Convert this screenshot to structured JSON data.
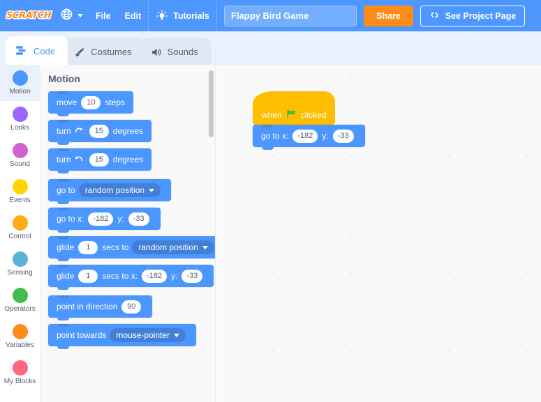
{
  "theme": {
    "menubar_bg": "#4d97ff",
    "accent_blue": "#4c97ff",
    "share_orange": "#ff8c1a",
    "tabstrip_bg": "#e9f1fc",
    "palette_bg": "#f9f9f9",
    "motion_block": "#4c97ff",
    "events_block": "#ffbf00",
    "text_gray": "#575e75"
  },
  "menubar": {
    "logo_text": "SCRATCH",
    "logo_icon": "scratch-logo",
    "language_icon": "globe-icon",
    "language_caret_icon": "chevron-down-icon",
    "file_label": "File",
    "edit_label": "Edit",
    "tutorials_icon": "lightbulb-icon",
    "tutorials_label": "Tutorials",
    "project_title_value": "Flappy Bird Game",
    "project_title_placeholder": "Project title",
    "share_label": "Share",
    "see_project_icon": "link-icon",
    "see_project_label": "See Project Page"
  },
  "tabs": [
    {
      "label": "Code",
      "icon": "code-blocks-icon",
      "active": true
    },
    {
      "label": "Costumes",
      "icon": "paintbrush-icon",
      "active": false
    },
    {
      "label": "Sounds",
      "icon": "speaker-icon",
      "active": false
    }
  ],
  "categories": [
    {
      "label": "Motion",
      "color": "#4c97ff",
      "selected": true
    },
    {
      "label": "Looks",
      "color": "#9966ff",
      "selected": false
    },
    {
      "label": "Sound",
      "color": "#cf63cf",
      "selected": false
    },
    {
      "label": "Events",
      "color": "#ffd500",
      "selected": false
    },
    {
      "label": "Control",
      "color": "#ffab19",
      "selected": false
    },
    {
      "label": "Sensing",
      "color": "#5cb1d6",
      "selected": false
    },
    {
      "label": "Operators",
      "color": "#40bf4a",
      "selected": false
    },
    {
      "label": "Variables",
      "color": "#ff8c1a",
      "selected": false
    },
    {
      "label": "My Blocks",
      "color": "#ff6680",
      "selected": false
    }
  ],
  "palette": {
    "header": "Motion",
    "scrollbar": {
      "name": "palette-scrollbar"
    },
    "blocks": [
      {
        "name": "move-steps-block",
        "parts": [
          {
            "type": "label",
            "text": "move"
          },
          {
            "type": "number",
            "value": "10"
          },
          {
            "type": "label",
            "text": "steps"
          }
        ]
      },
      {
        "name": "turn-right-degrees-block",
        "parts": [
          {
            "type": "label",
            "text": "turn"
          },
          {
            "type": "icon",
            "icon": "turn-clockwise-icon"
          },
          {
            "type": "number",
            "value": "15"
          },
          {
            "type": "label",
            "text": "degrees"
          }
        ]
      },
      {
        "name": "turn-left-degrees-block",
        "parts": [
          {
            "type": "label",
            "text": "turn"
          },
          {
            "type": "icon",
            "icon": "turn-counterclockwise-icon"
          },
          {
            "type": "number",
            "value": "15"
          },
          {
            "type": "label",
            "text": "degrees"
          }
        ]
      },
      {
        "name": "go-to-block",
        "parts": [
          {
            "type": "label",
            "text": "go to"
          },
          {
            "type": "dropdown",
            "value": "random position"
          }
        ]
      },
      {
        "name": "go-to-xy-block",
        "parts": [
          {
            "type": "label",
            "text": "go to x:"
          },
          {
            "type": "number",
            "value": "-182"
          },
          {
            "type": "label",
            "text": "y:"
          },
          {
            "type": "number",
            "value": "-33"
          }
        ]
      },
      {
        "name": "glide-secs-to-block",
        "parts": [
          {
            "type": "label",
            "text": "glide"
          },
          {
            "type": "number",
            "value": "1"
          },
          {
            "type": "label",
            "text": "secs to"
          },
          {
            "type": "dropdown",
            "value": "random position"
          }
        ]
      },
      {
        "name": "glide-secs-to-xy-block",
        "parts": [
          {
            "type": "label",
            "text": "glide"
          },
          {
            "type": "number",
            "value": "1"
          },
          {
            "type": "label",
            "text": "secs to x:"
          },
          {
            "type": "number",
            "value": "-182"
          },
          {
            "type": "label",
            "text": "y:"
          },
          {
            "type": "number",
            "value": "-33"
          }
        ]
      },
      {
        "name": "point-in-direction-block",
        "parts": [
          {
            "type": "label",
            "text": "point in direction"
          },
          {
            "type": "number",
            "value": "90"
          }
        ]
      },
      {
        "name": "point-towards-block",
        "parts": [
          {
            "type": "label",
            "text": "point towards"
          },
          {
            "type": "dropdown",
            "value": "mouse-pointer"
          }
        ]
      }
    ]
  },
  "workspace": {
    "script": {
      "hat": {
        "name": "when-green-flag-clicked-block",
        "prefix": "when",
        "icon": "green-flag-icon",
        "suffix": "clicked"
      },
      "body": [
        {
          "name": "go-to-xy-block",
          "parts": [
            {
              "type": "label",
              "text": "go to x:"
            },
            {
              "type": "number",
              "value": "-182"
            },
            {
              "type": "label",
              "text": "y:"
            },
            {
              "type": "number",
              "value": "-33"
            }
          ]
        }
      ]
    }
  }
}
